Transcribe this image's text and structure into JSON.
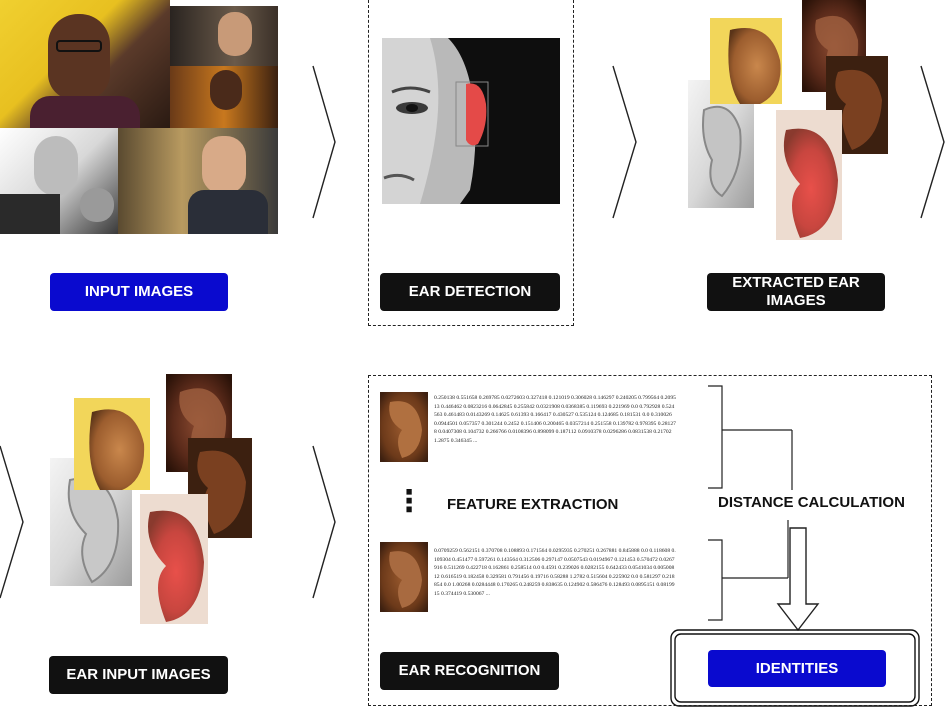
{
  "steps": {
    "input_images": "INPUT IMAGES",
    "ear_detection": "EAR DETECTION",
    "extracted_ear_images": "EXTRACTED EAR IMAGES",
    "ear_input_images": "EAR INPUT IMAGES",
    "ear_recognition": "EAR RECOGNITION",
    "identities": "IDENTITIES"
  },
  "feature_extraction": "FEATURE EXTRACTION",
  "distance_calculation": "DISTANCE CALCULATION",
  "vector_ellipsis": "⋮",
  "feature_vector_1": "0.250138 0.551658 0.269785 0.0272603 0.327418 0.121019 0.306028 0.146297 0.240205 0.799564 0.209513 0.446462 0.0823216 0.0642845 0.255842 0.0321908 0.0368385 0.119693 0.221969 0.0 0.792928 0.524563 0.461483 0.0143269 0.14625 0.61393 0.166417 0.430527 0.535124 0.124685 0.181531 0.0 0.310026 0.0944501 0.057357 0.301244 0.2452 0.151406 0.200465 0.0357214 0.251558 0.139782 0.978395 0.281278 0.0407308 0.104732 0.266766 0.0108396 0.898099 0.187112 0.0910378 0.0296286 0.0831538 0.21702 1.2875 0.346345 ...",
  "feature_vector_2": "0.0709259 0.562151 0.370708 0.108893 0.171564 0.0295935 0.270251 0.267881 0.845888 0.0 0.118608 0.109304 0.451477 0.597261 0.143564 0.312506 0.297147 0.0507543 0.0194967 0.121453 0.570472 0.0267916 0.511269 0.422718 0.162861 0.258514 0.0 0.4591 0.239026 0.0282155 0.642433 0.0541034 0.00500812 0.616519 0.182458 0.329581 0.791456 0.19716 0.58288 1.2782 0.515604 0.225902 0.0 0.581297 0.218854 0.0 1.00268 0.0284448 0.170265 0.248259 0.838635 0.124902 0.586476 0.128493 0.0895151 0.0819915 0.374419 0.530067 ...",
  "colors": {
    "dark_label": "#111111",
    "blue_label": "#0a0acf"
  }
}
